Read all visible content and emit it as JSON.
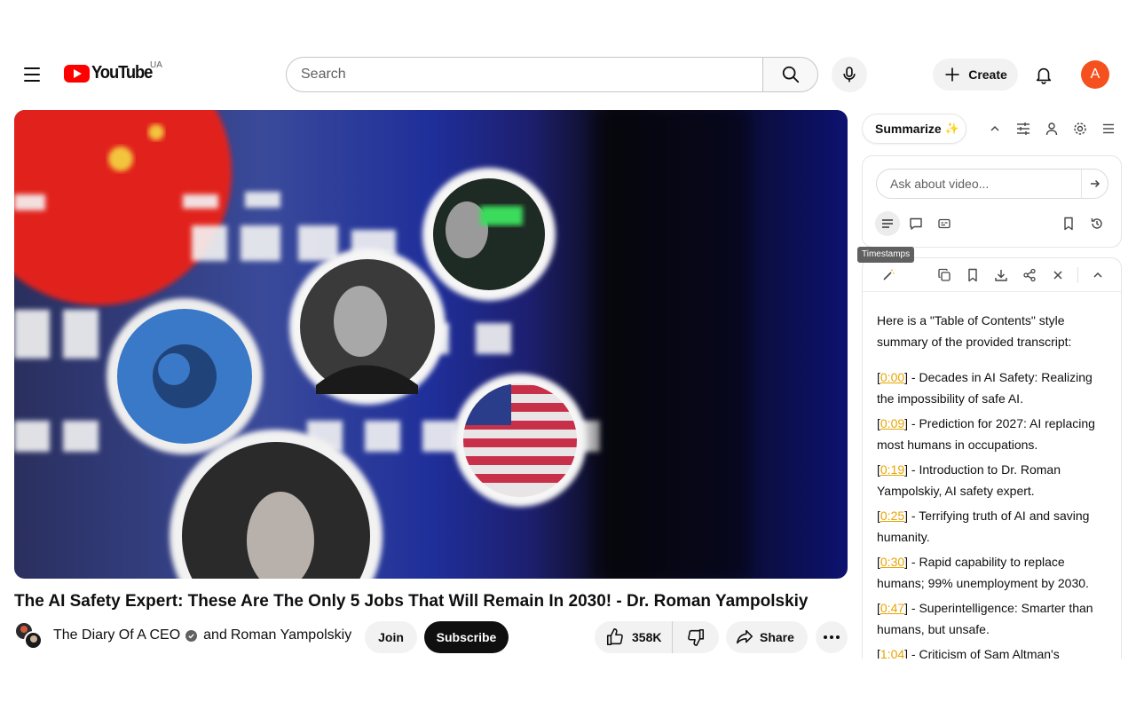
{
  "header": {
    "logo_text": "YouTube",
    "country_code": "UA",
    "search_placeholder": "Search",
    "create_label": "Create",
    "avatar_letter": "A"
  },
  "video": {
    "title": "The AI Safety Expert: These Are The Only 5 Jobs That Will Remain In 2030! - Dr. Roman Yampolskiy",
    "channel": "The Diary Of A CEO",
    "collaborator_prefix": "and",
    "collaborator": "Roman Yampolskiy",
    "join_label": "Join",
    "subscribe_label": "Subscribe",
    "likes": "358K",
    "share_label": "Share"
  },
  "summarize": {
    "button_label": "Summarize",
    "sparkle": "✨",
    "ask_placeholder": "Ask about video...",
    "tooltip": "Timestamps",
    "intro": "Here is a \"Table of Contents\" style summary of the provided transcript:",
    "items": [
      {
        "time": "0:00",
        "text": " - Decades in AI Safety: Realizing the impossibility of safe AI."
      },
      {
        "time": "0:09",
        "text": " - Prediction for 2027: AI replacing most humans in occupations."
      },
      {
        "time": "0:19",
        "text": " - Introduction to Dr. Roman Yampolskiy, AI safety expert."
      },
      {
        "time": "0:25",
        "text": " - Terrifying truth of AI and saving humanity."
      },
      {
        "time": "0:30",
        "text": " - Rapid capability to replace humans; 99% unemployment by 2030."
      },
      {
        "time": "0:47",
        "text": " - Superintelligence: Smarter than humans, but unsafe."
      },
      {
        "time": "1:04",
        "text": " - Criticism of Sam Altman's"
      }
    ]
  },
  "colors": {
    "accent_red": "#ff0000",
    "avatar_bg": "#f4511e",
    "timestamp_link": "#e8a400"
  }
}
